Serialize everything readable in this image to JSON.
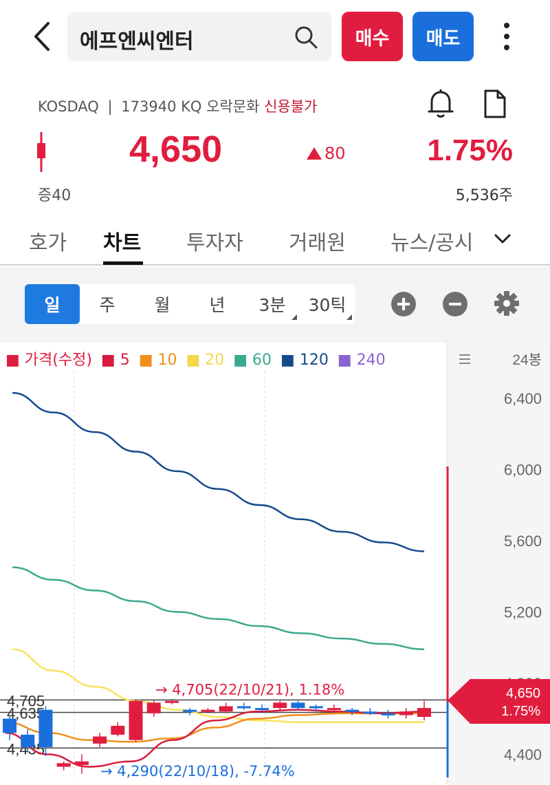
{
  "header": {
    "search_value": "에프엔씨엔터",
    "buy_label": "매수",
    "sell_label": "매도",
    "icons": [
      "back-icon",
      "search-icon",
      "more-icon",
      "bell-icon",
      "document-icon"
    ]
  },
  "stock": {
    "market": "KOSDAQ",
    "separator": "|",
    "code": "173940 KQ",
    "sector": "오락문화",
    "credit_status": "신용불가",
    "price": "4,650",
    "change": "80",
    "change_pct": "1.75%",
    "open_info": "증40",
    "volume": "5,536주"
  },
  "tabs": [
    {
      "label": "호가"
    },
    {
      "label": "차트",
      "active": true
    },
    {
      "label": "투자자"
    },
    {
      "label": "거래원"
    },
    {
      "label": "뉴스/공시"
    }
  ],
  "periods": [
    {
      "label": "일",
      "active": true
    },
    {
      "label": "주"
    },
    {
      "label": "월"
    },
    {
      "label": "년"
    },
    {
      "label": "3분"
    },
    {
      "label": "30틱"
    }
  ],
  "colors": {
    "up": "#e11d3f",
    "down": "#1a6fdc",
    "ma5": "#d81b3c",
    "ma10": "#f0901a",
    "ma20": "#f6e35a",
    "ma60": "#3aa98f",
    "ma120": "#174a8c",
    "ma240": "#8a63d2"
  },
  "chart_data": {
    "type": "line",
    "title": "",
    "legend": [
      "가격(수정)",
      "5",
      "10",
      "20",
      "60",
      "120",
      "240"
    ],
    "bar_count_label": "24봉",
    "y_ticks": [
      6400,
      6000,
      5600,
      5200,
      4800,
      4400
    ],
    "ylim": [
      4270,
      6550
    ],
    "y_axis_position": "right",
    "current_price_label": "4,650",
    "current_pct_label": "1.75%",
    "ref_lines": [
      4705,
      4635,
      4435
    ],
    "ref_labels": [
      "4,705",
      "4,635",
      "4,435"
    ],
    "high_annotation": "→ 4,705(22/10/21), 1.18%",
    "low_annotation": "→ 4,290(22/10/18), -7.74%",
    "series": [
      {
        "name": "120",
        "values": [
          6430,
          6320,
          6210,
          6100,
          5990,
          5890,
          5800,
          5720,
          5650,
          5590,
          5540
        ]
      },
      {
        "name": "60",
        "values": [
          5450,
          5380,
          5320,
          5260,
          5200,
          5160,
          5120,
          5080,
          5050,
          5020,
          4990
        ]
      },
      {
        "name": "20",
        "values": [
          4990,
          4870,
          4780,
          4700,
          4650,
          4610,
          4590,
          4580,
          4580,
          4580,
          4580
        ]
      },
      {
        "name": "10",
        "values": [
          4580,
          4520,
          4480,
          4470,
          4490,
          4550,
          4600,
          4620,
          4630,
          4630,
          4630
        ]
      },
      {
        "name": "5",
        "values": [
          4520,
          4400,
          4330,
          4360,
          4480,
          4590,
          4640,
          4650,
          4640,
          4630,
          4640
        ]
      }
    ],
    "candles": [
      {
        "o": 4600,
        "c": 4520,
        "h": 4620,
        "l": 4480
      },
      {
        "o": 4510,
        "c": 4440,
        "h": 4540,
        "l": 4410
      },
      {
        "o": 4650,
        "c": 4440,
        "h": 4670,
        "l": 4390
      },
      {
        "o": 4330,
        "c": 4350,
        "h": 4360,
        "l": 4310
      },
      {
        "o": 4340,
        "c": 4360,
        "h": 4400,
        "l": 4290
      },
      {
        "o": 4460,
        "c": 4500,
        "h": 4520,
        "l": 4440
      },
      {
        "o": 4510,
        "c": 4560,
        "h": 4580,
        "l": 4500
      },
      {
        "o": 4480,
        "c": 4700,
        "h": 4705,
        "l": 4470
      },
      {
        "o": 4630,
        "c": 4690,
        "h": 4705,
        "l": 4610
      },
      {
        "o": 4690,
        "c": 4700,
        "h": 4705,
        "l": 4680
      },
      {
        "o": 4650,
        "c": 4640,
        "h": 4660,
        "l": 4620
      },
      {
        "o": 4640,
        "c": 4650,
        "h": 4660,
        "l": 4630
      },
      {
        "o": 4640,
        "c": 4670,
        "h": 4690,
        "l": 4630
      },
      {
        "o": 4670,
        "c": 4660,
        "h": 4690,
        "l": 4650
      },
      {
        "o": 4660,
        "c": 4650,
        "h": 4680,
        "l": 4640
      },
      {
        "o": 4660,
        "c": 4690,
        "h": 4700,
        "l": 4650
      },
      {
        "o": 4690,
        "c": 4660,
        "h": 4700,
        "l": 4650
      },
      {
        "o": 4670,
        "c": 4660,
        "h": 4680,
        "l": 4640
      },
      {
        "o": 4660,
        "c": 4660,
        "h": 4680,
        "l": 4640
      },
      {
        "o": 4650,
        "c": 4640,
        "h": 4660,
        "l": 4620
      },
      {
        "o": 4640,
        "c": 4630,
        "h": 4660,
        "l": 4620
      },
      {
        "o": 4630,
        "c": 4620,
        "h": 4650,
        "l": 4600
      },
      {
        "o": 4620,
        "c": 4640,
        "h": 4660,
        "l": 4600
      },
      {
        "o": 4610,
        "c": 4660,
        "h": 4700,
        "l": 4590
      }
    ]
  }
}
